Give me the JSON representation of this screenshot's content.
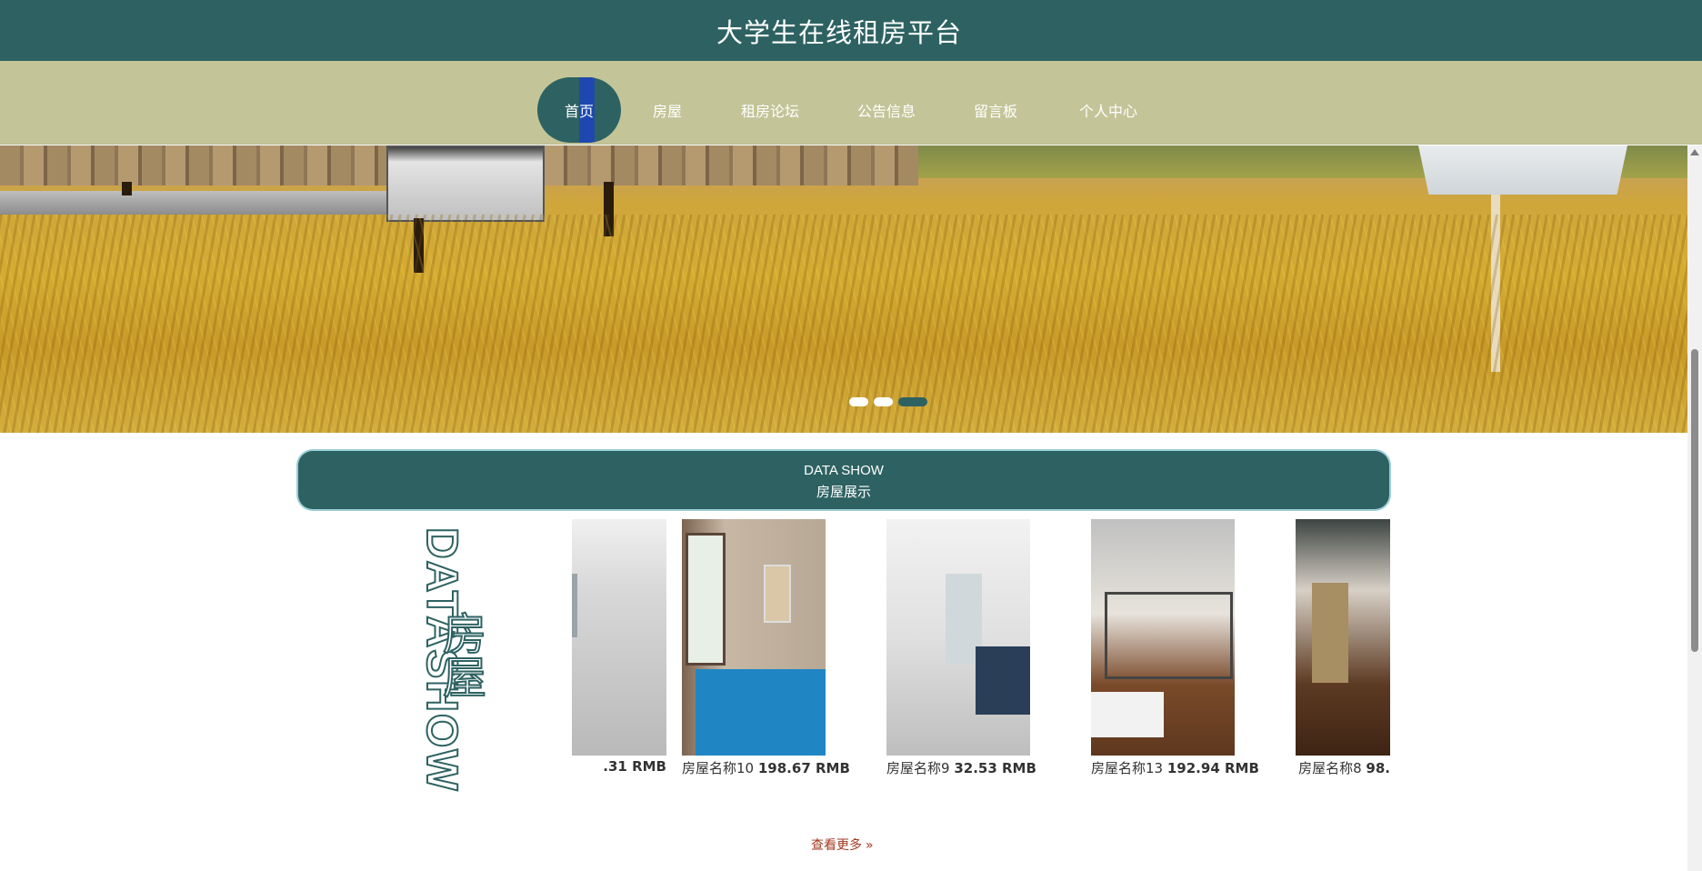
{
  "header": {
    "site_title": "大学生在线租房平台"
  },
  "nav": {
    "items": [
      {
        "label": "首页",
        "active": true
      },
      {
        "label": "房屋"
      },
      {
        "label": "租房论坛"
      },
      {
        "label": "公告信息"
      },
      {
        "label": "留言板"
      },
      {
        "label": "个人中心"
      }
    ]
  },
  "banner": {
    "slide_count": 3,
    "active_slide": 3
  },
  "section": {
    "title_en": "DATA SHOW",
    "title_cn": "房屋展示",
    "side_en": "DATASHOW",
    "side_cn": "房屋"
  },
  "houses": [
    {
      "name": "",
      "price": ".31 RMB"
    },
    {
      "name": "房屋名称10",
      "price": "198.67 RMB"
    },
    {
      "name": "房屋名称9",
      "price": "32.53 RMB"
    },
    {
      "name": "房屋名称13",
      "price": "192.94 RMB"
    },
    {
      "name": "房屋名称8",
      "price": "98."
    }
  ],
  "more": {
    "label": "查看更多",
    "icon": "double-chevron-right-icon"
  },
  "colors": {
    "primary": "#2e6262",
    "nav_bg": "#c3c598",
    "more_link": "#a2381e",
    "active_stripe": "#1e48b0"
  }
}
